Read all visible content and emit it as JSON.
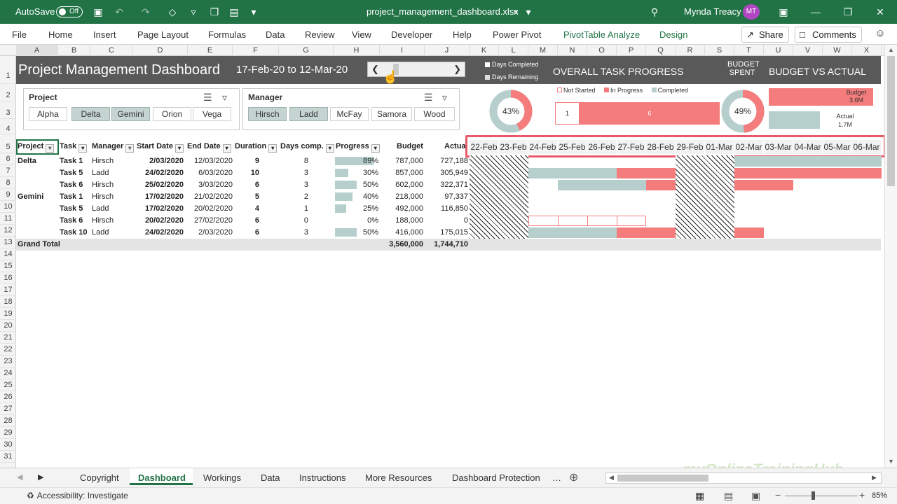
{
  "titlebar": {
    "autosave_label": "AutoSave",
    "autosave_state": "Off",
    "filename": "project_management_dashboard.xlsx",
    "user_name": "Mynda Treacy",
    "user_initials": "MT"
  },
  "ribbon": {
    "tabs": [
      "File",
      "Home",
      "Insert",
      "Page Layout",
      "Formulas",
      "Data",
      "Review",
      "View",
      "Developer",
      "Help",
      "Power Pivot",
      "PivotTable Analyze",
      "Design"
    ],
    "share_label": "Share",
    "comments_label": "Comments"
  },
  "columns": [
    "A",
    "B",
    "C",
    "D",
    "E",
    "F",
    "G",
    "H",
    "I",
    "J",
    "K",
    "L",
    "M",
    "N",
    "O",
    "P",
    "Q",
    "R",
    "S",
    "T",
    "U",
    "V",
    "W",
    "X"
  ],
  "rows": [
    "1",
    "2",
    "3",
    "4",
    "5",
    "6",
    "7",
    "8",
    "9",
    "10",
    "11",
    "12",
    "13",
    "14",
    "15",
    "16",
    "17",
    "18",
    "19",
    "20",
    "21",
    "22",
    "23",
    "24",
    "25",
    "26",
    "27",
    "28",
    "29",
    "30",
    "31"
  ],
  "dashboard": {
    "title": "Project Management Dashboard",
    "date_range": "17-Feb-20 to 12-Mar-20",
    "legend_days_completed": "Days Completed",
    "legend_days_remaining": "Days Remaining",
    "overall_title": "OVERALL TASK PROGRESS",
    "budget_spent_line1": "BUDGET",
    "budget_spent_line2": "SPENT",
    "budget_vs_actual_title": "BUDGET VS ACTUAL",
    "task_progress_pct": "43%",
    "budget_spent_pct": "49%",
    "status_legend": {
      "not_started": "Not Started",
      "in_progress": "In Progress",
      "completed": "Completed"
    },
    "status_bar": {
      "not_started": "1",
      "in_progress": "6"
    },
    "budget_label": "Budget",
    "budget_value": "3.6M",
    "actual_label": "Actual",
    "actual_value": "1.7M"
  },
  "slicers": {
    "project": {
      "title": "Project",
      "items": [
        "Alpha",
        "Delta",
        "Gemini",
        "Orion",
        "Vega"
      ],
      "selected": [
        "Delta",
        "Gemini"
      ]
    },
    "manager": {
      "title": "Manager",
      "items": [
        "Hirsch",
        "Ladd",
        "McFay",
        "Samora",
        "Wood"
      ],
      "selected": [
        "Hirsch",
        "Ladd"
      ]
    }
  },
  "table": {
    "headers": {
      "project": "Project",
      "task": "Task",
      "manager": "Manager",
      "start": "Start Date",
      "end": "End Date",
      "duration": "Duration",
      "days_comp": "Days comp.",
      "progress": "Progress",
      "budget": "Budget",
      "actual": "Actual"
    },
    "rows": [
      {
        "project": "Delta",
        "task": "Task 1",
        "manager": "Hirsch",
        "start": "2/03/2020",
        "end": "12/03/2020",
        "duration": "9",
        "days_comp": "8",
        "progress": "89%",
        "progress_value": 0.89,
        "budget": "787,000",
        "actual": "727,188"
      },
      {
        "project": "",
        "task": "Task 5",
        "manager": "Ladd",
        "start": "24/02/2020",
        "end": "6/03/2020",
        "duration": "10",
        "days_comp": "3",
        "progress": "30%",
        "progress_value": 0.3,
        "budget": "857,000",
        "actual": "305,949"
      },
      {
        "project": "",
        "task": "Task 6",
        "manager": "Hirsch",
        "start": "25/02/2020",
        "end": "3/03/2020",
        "duration": "6",
        "days_comp": "3",
        "progress": "50%",
        "progress_value": 0.5,
        "budget": "602,000",
        "actual": "322,371"
      },
      {
        "project": "Gemini",
        "task": "Task 1",
        "manager": "Hirsch",
        "start": "17/02/2020",
        "end": "21/02/2020",
        "duration": "5",
        "days_comp": "2",
        "progress": "40%",
        "progress_value": 0.4,
        "budget": "218,000",
        "actual": "97,337"
      },
      {
        "project": "",
        "task": "Task 5",
        "manager": "Ladd",
        "start": "17/02/2020",
        "end": "20/02/2020",
        "duration": "4",
        "days_comp": "1",
        "progress": "25%",
        "progress_value": 0.25,
        "budget": "492,000",
        "actual": "116,850"
      },
      {
        "project": "",
        "task": "Task 6",
        "manager": "Hirsch",
        "start": "20/02/2020",
        "end": "27/02/2020",
        "duration": "6",
        "days_comp": "0",
        "progress": "0%",
        "progress_value": 0,
        "budget": "188,000",
        "actual": "0"
      },
      {
        "project": "",
        "task": "Task 10",
        "manager": "Ladd",
        "start": "24/02/2020",
        "end": "2/03/2020",
        "duration": "6",
        "days_comp": "3",
        "progress": "50%",
        "progress_value": 0.5,
        "budget": "416,000",
        "actual": "175,015"
      }
    ],
    "grand_total": {
      "label": "Grand Total",
      "budget": "3,560,000",
      "actual": "1,744,710"
    }
  },
  "gantt_dates": [
    "22-Feb",
    "23-Feb",
    "24-Feb",
    "25-Feb",
    "26-Feb",
    "27-Feb",
    "28-Feb",
    "29-Feb",
    "01-Mar",
    "02-Mar",
    "03-Mar",
    "04-Mar",
    "05-Mar",
    "06-Mar"
  ],
  "sheet_tabs": [
    "Copyright",
    "Dashboard",
    "Workings",
    "Data",
    "Instructions",
    "More Resources",
    "Dashboard Protection"
  ],
  "active_sheet": "Dashboard",
  "status": {
    "accessibility": "Accessibility: Investigate",
    "zoom": "85%"
  },
  "watermark": "myOnlineTrainingHub",
  "colors": {
    "excel_green": "#217346",
    "dark_band": "#595959",
    "in_progress": "#f47c7c",
    "completed": "#b7cfcc",
    "highlight": "#e85a6a"
  }
}
